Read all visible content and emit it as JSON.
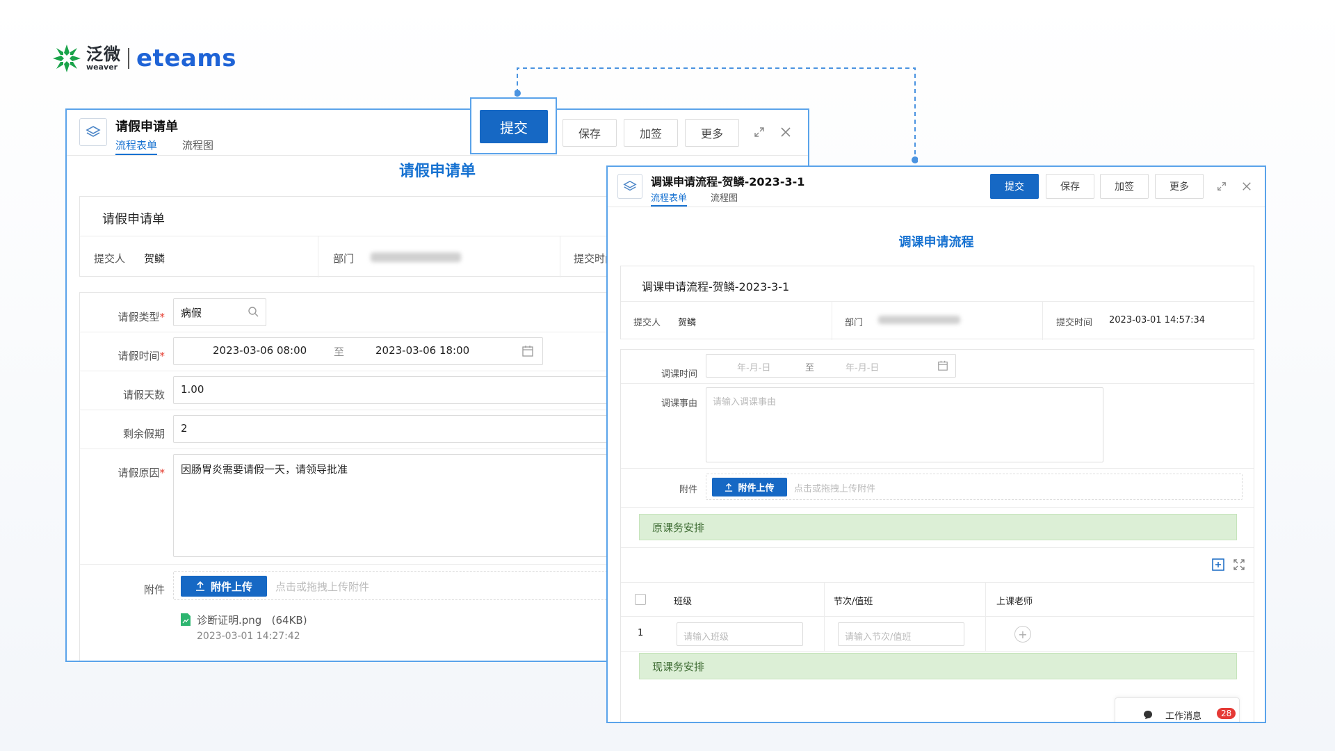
{
  "logo": {
    "brand_cn": "泛微",
    "brand_en_small": "weaver",
    "product": "eteams",
    "brand_color": "#1e63d6",
    "mark_color": "#1aa34a"
  },
  "callout": {
    "submit_label": "提交"
  },
  "winA": {
    "title": "请假申请单",
    "tabs": [
      "流程表单",
      "流程图"
    ],
    "buttons": {
      "save": "保存",
      "countersign": "加签",
      "more": "更多"
    },
    "form_title": "请假申请单",
    "card_title": "请假申请单",
    "meta": {
      "submitter_label": "提交人",
      "submitter_value": "贺鳞",
      "dept_label": "部门",
      "submit_time_label": "提交时间"
    },
    "fields": {
      "leave_type_label": "请假类型",
      "leave_type_value": "病假",
      "leave_time_label": "请假时间",
      "leave_start": "2023-03-06 08:00",
      "range_sep": "至",
      "leave_end": "2023-03-06 18:00",
      "leave_days_label": "请假天数",
      "leave_days_value": "1.00",
      "remaining_label": "剩余假期",
      "remaining_value": "2",
      "reason_label": "请假原因",
      "reason_value": "因肠胃炎需要请假一天，请领导批准",
      "attach_label": "附件",
      "upload_label": "附件上传",
      "upload_hint": "点击或拖拽上传附件",
      "file_name": "诊断证明.png",
      "file_size": "(64KB)",
      "file_time": "2023-03-01 14:27:42"
    }
  },
  "winB": {
    "title": "调课申请流程-贺鳞-2023-3-1",
    "tabs": [
      "流程表单",
      "流程图"
    ],
    "buttons": {
      "submit": "提交",
      "save": "保存",
      "countersign": "加签",
      "more": "更多"
    },
    "form_title": "调课申请流程",
    "card_title": "调课申请流程-贺鳞-2023-3-1",
    "meta": {
      "submitter_label": "提交人",
      "submitter_value": "贺鳞",
      "dept_label": "部门",
      "submit_time_label": "提交时间",
      "submit_time_value": "2023-03-01 14:57:34"
    },
    "fields": {
      "time_label": "调课时间",
      "date_ph": "年-月-日",
      "range_sep": "至",
      "reason_label": "调课事由",
      "reason_ph": "请输入调课事由",
      "attach_label": "附件",
      "upload_label": "附件上传",
      "upload_hint": "点击或拖拽上传附件"
    },
    "section_original": "原课务安排",
    "section_current": "现课务安排",
    "table": {
      "headers": [
        "班级",
        "节次/值班",
        "上课老师"
      ],
      "row_index": "1",
      "class_ph": "请输入班级",
      "period_ph": "请输入节次/值班"
    },
    "messages": {
      "label": "工作消息",
      "count": "28"
    }
  }
}
